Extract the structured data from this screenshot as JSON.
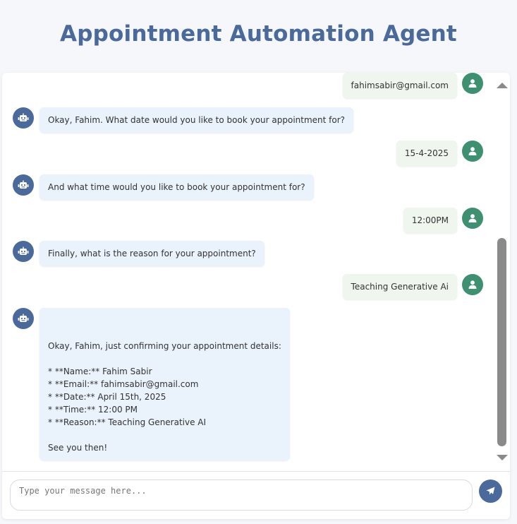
{
  "header": {
    "title": "Appointment Automation Agent"
  },
  "messages": [
    {
      "role": "user",
      "text": "fahimsabir@gmail.com"
    },
    {
      "role": "bot",
      "text": "Okay, Fahim. What date would you like to book your appointment for?"
    },
    {
      "role": "user",
      "text": "15-4-2025"
    },
    {
      "role": "bot",
      "text": "And what time would you like to book your appointment for?"
    },
    {
      "role": "user",
      "text": "12:00PM"
    },
    {
      "role": "bot",
      "text": "Finally, what is the reason for your appointment?"
    },
    {
      "role": "user",
      "text": "Teaching Generative Ai"
    },
    {
      "role": "bot",
      "text": "\n\nOkay, Fahim, just confirming your appointment details:\n\n* **Name:** Fahim Sabir\n* **Email:** fahimsabir@gmail.com\n* **Date:** April 15th, 2025\n* **Time:** 12:00 PM\n* **Reason:** Teaching Generative AI\n\nSee you then!"
    }
  ],
  "input": {
    "placeholder": "Type your message here..."
  },
  "colors": {
    "title": "#4a6a9c",
    "bot_avatar": "#4a6a9c",
    "user_avatar": "#3d9171",
    "bot_bubble": "#eaf2fb",
    "user_bubble": "#eef6ee",
    "send_button": "#4a6a9c"
  },
  "icons": {
    "bot": "robot-icon",
    "user": "user-icon",
    "send": "paper-plane-icon"
  }
}
